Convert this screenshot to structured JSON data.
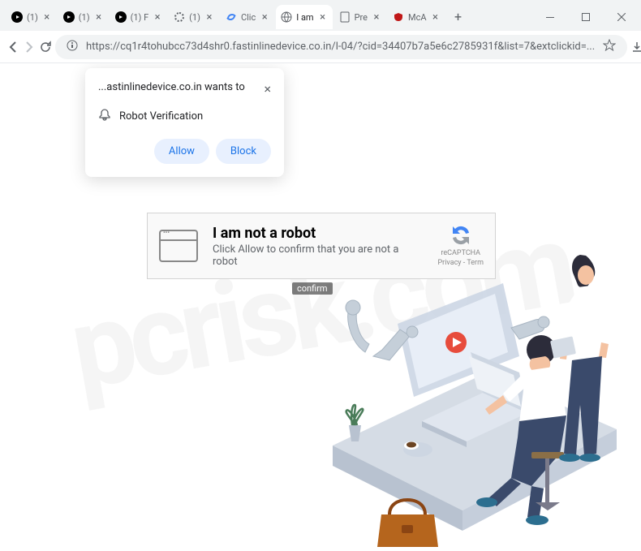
{
  "titlebar": {
    "tabs": [
      {
        "title": "(1)",
        "type": "youtube"
      },
      {
        "title": "(1)",
        "type": "youtube"
      },
      {
        "title": "(1) F",
        "type": "youtube"
      },
      {
        "title": "(1)",
        "type": "loading"
      },
      {
        "title": "Clic",
        "type": "recaptcha"
      },
      {
        "title": "I am",
        "type": "globe",
        "active": true
      },
      {
        "title": "Pre",
        "type": "blank"
      },
      {
        "title": "McA",
        "type": "mcafee"
      }
    ]
  },
  "toolbar": {
    "url": "https://cq1r4tohubcc73d4shr0.fastinlinedevice.co.in/l-04/?cid=34407b7a5e6c2785931f&list=7&extclickid=..."
  },
  "notification": {
    "domain": "...astinlinedevice.co.in wants to",
    "permission": "Robot Verification",
    "allow": "Allow",
    "block": "Block"
  },
  "captcha": {
    "title": "I am not a robot",
    "subtitle": "Click Allow to confirm that you are not a robot",
    "badge": "reCAPTCHA",
    "badge_sub": "Privacy - Term"
  },
  "confirm_label": "confirm",
  "watermark": "pcrisk.com"
}
